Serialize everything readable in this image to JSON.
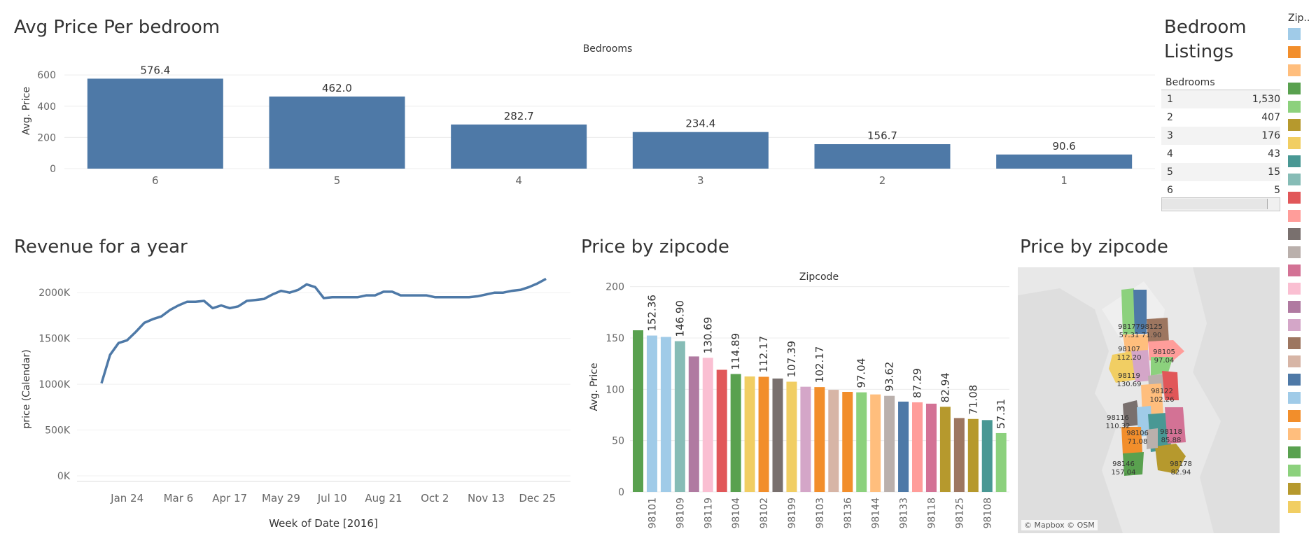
{
  "dashboard": {
    "avg_price_title": "Avg Price Per bedroom",
    "revenue_title": "Revenue for a year",
    "zip_bar_title": "Price by zipcode",
    "map_title": "Price by zipcode",
    "listings_title_line1": "Bedroom",
    "listings_title_line2": "Listings",
    "map_credit": "© Mapbox © OSM",
    "legend_title": "Zip..",
    "legend_colors": [
      "#a0cbe8",
      "#f28e2b",
      "#ffbe7d",
      "#59a14f",
      "#8cd17d",
      "#b6992d",
      "#f1ce63",
      "#499894",
      "#86bcb6",
      "#e15759",
      "#ff9d9a",
      "#79706e",
      "#bab0ac",
      "#d37295",
      "#fabfd2",
      "#b07aa1",
      "#d4a6c8",
      "#9d7660",
      "#d7b5a6",
      "#4e79a7",
      "#a0cbe8",
      "#f28e2b",
      "#ffbe7d",
      "#59a14f",
      "#8cd17d",
      "#b6992d",
      "#f1ce63"
    ]
  },
  "listings_table": {
    "header": "Bedrooms",
    "rows": [
      {
        "bedrooms": "1",
        "count": "1,530"
      },
      {
        "bedrooms": "2",
        "count": "407"
      },
      {
        "bedrooms": "3",
        "count": "176"
      },
      {
        "bedrooms": "4",
        "count": "43"
      },
      {
        "bedrooms": "5",
        "count": "15"
      },
      {
        "bedrooms": "6",
        "count": "5"
      }
    ]
  },
  "map_labels": [
    {
      "zip": "98177",
      "price": "57.31"
    },
    {
      "zip": "98125",
      "price": "71.90"
    },
    {
      "zip": "98107",
      "price": "112.20"
    },
    {
      "zip": "98105",
      "price": "97.04"
    },
    {
      "zip": "98119",
      "price": "130.69"
    },
    {
      "zip": "98122",
      "price": "102.26"
    },
    {
      "zip": "98116",
      "price": "110.32"
    },
    {
      "zip": "98106",
      "price": "71.08"
    },
    {
      "zip": "98118",
      "price": "85.88"
    },
    {
      "zip": "98146",
      "price": "157.04"
    },
    {
      "zip": "98178",
      "price": "82.94"
    }
  ],
  "chart_data": [
    {
      "type": "bar",
      "title": "Avg Price Per bedroom",
      "column_header": "Bedrooms",
      "ylabel": "Avg. Price",
      "ylim": [
        0,
        650
      ],
      "yticks": [
        0,
        200,
        400,
        600
      ],
      "categories": [
        "6",
        "5",
        "4",
        "3",
        "2",
        "1"
      ],
      "values": [
        576.4,
        462.0,
        282.7,
        234.4,
        156.7,
        90.6
      ],
      "value_labels": [
        "576.4",
        "462.0",
        "282.7",
        "234.4",
        "156.7",
        "90.6"
      ],
      "color": "#4e79a7",
      "grid": true
    },
    {
      "type": "line",
      "title": "Revenue for a year",
      "xlabel": "Week of Date [2016]",
      "ylabel": "price (Calendar)",
      "ylim": [
        0,
        2200000
      ],
      "yticks": [
        0,
        500000,
        1000000,
        1500000,
        2000000
      ],
      "ytick_labels": [
        "0K",
        "500K",
        "1000K",
        "1500K",
        "2000K"
      ],
      "xtick_labels": [
        "Jan 24",
        "Mar 6",
        "Apr 17",
        "May 29",
        "Jul 10",
        "Aug 21",
        "Oct 2",
        "Nov 13",
        "Dec 25"
      ],
      "xtick_weeks": [
        3,
        9,
        15,
        21,
        27,
        33,
        39,
        45,
        51
      ],
      "x_weeks": [
        0,
        1,
        2,
        3,
        4,
        5,
        6,
        7,
        8,
        9,
        10,
        11,
        12,
        13,
        14,
        15,
        16,
        17,
        18,
        19,
        20,
        21,
        22,
        23,
        24,
        25,
        26,
        27,
        28,
        29,
        30,
        31,
        32,
        33,
        34,
        35,
        36,
        37,
        38,
        39,
        40,
        41,
        42,
        43,
        44,
        45,
        46,
        47,
        48,
        49,
        50,
        51,
        52
      ],
      "values": [
        1010000,
        1320000,
        1450000,
        1480000,
        1570000,
        1670000,
        1710000,
        1740000,
        1810000,
        1860000,
        1900000,
        1900000,
        1910000,
        1830000,
        1860000,
        1830000,
        1850000,
        1910000,
        1920000,
        1930000,
        1980000,
        2020000,
        2000000,
        2030000,
        2090000,
        2060000,
        1940000,
        1950000,
        1950000,
        1950000,
        1950000,
        1970000,
        1970000,
        2010000,
        2010000,
        1970000,
        1970000,
        1970000,
        1970000,
        1950000,
        1950000,
        1950000,
        1950000,
        1950000,
        1960000,
        1980000,
        2000000,
        2000000,
        2020000,
        2030000,
        2060000,
        2100000,
        2150000
      ],
      "color": "#4e79a7",
      "grid": true
    },
    {
      "type": "bar",
      "title": "Price by zipcode",
      "column_header": "Zipcode",
      "ylabel": "Avg. Price",
      "ylim": [
        0,
        210
      ],
      "yticks": [
        0,
        50,
        100,
        150,
        200
      ],
      "values": [
        157.5,
        152.36,
        151.0,
        146.9,
        132.0,
        130.69,
        119.0,
        114.89,
        112.5,
        112.17,
        110.5,
        107.39,
        102.5,
        102.17,
        99.5,
        97.5,
        97.04,
        95.0,
        93.62,
        88.0,
        87.29,
        86.0,
        82.94,
        72.0,
        71.08,
        70.0,
        57.31
      ],
      "value_labels": [
        "",
        "152.36",
        "",
        "146.90",
        "",
        "130.69",
        "",
        "114.89",
        "",
        "112.17",
        "",
        "107.39",
        "",
        "102.17",
        "",
        "",
        "97.04",
        "",
        "93.62",
        "",
        "87.29",
        "",
        "82.94",
        "",
        "71.08",
        "",
        "57.31"
      ],
      "category_labels": [
        "",
        "98101",
        "",
        "98109",
        "",
        "98119",
        "",
        "98104",
        "",
        "98102",
        "",
        "98199",
        "",
        "98103",
        "",
        "98136",
        "",
        "98144",
        "",
        "98133",
        "",
        "98118",
        "",
        "98125",
        "",
        "98108",
        ""
      ],
      "colors": [
        "#59a14f",
        "#a0cbe8",
        "#a0cbe8",
        "#86bcb6",
        "#b07aa1",
        "#fabfd2",
        "#e15759",
        "#59a14f",
        "#f1ce63",
        "#f28e2b",
        "#79706e",
        "#f1ce63",
        "#d4a6c8",
        "#f28e2b",
        "#d7b5a6",
        "#f28e2b",
        "#8cd17d",
        "#ffbe7d",
        "#bab0ac",
        "#4e79a7",
        "#ff9d9a",
        "#d37295",
        "#b6992d",
        "#9d7660",
        "#b6992d",
        "#499894",
        "#8cd17d"
      ],
      "grid": true
    }
  ]
}
